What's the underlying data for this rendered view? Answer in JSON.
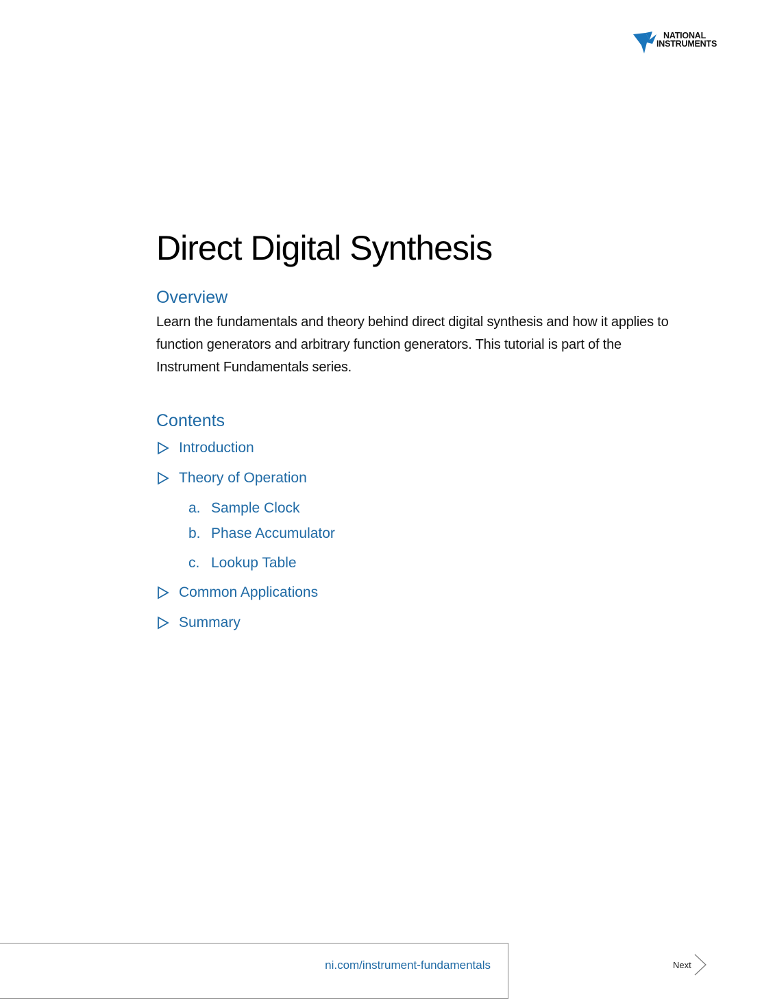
{
  "header": {
    "logo": {
      "icon": "ni-eagle-logo",
      "line1": "NATIONAL",
      "line2": "INSTRUMENTS",
      "brand_color": "#1a75bb"
    }
  },
  "document": {
    "title": "Direct Digital Synthesis",
    "overview": {
      "heading": "Overview",
      "body": "Learn the fundamentals and theory behind direct digital synthesis and how it applies to function generators and arbitrary function generators. This tutorial is part of the Instrument Fundamentals series."
    },
    "contents": {
      "heading": "Contents",
      "items": [
        {
          "label": "Introduction",
          "icon": "triangle-right-outline-icon"
        },
        {
          "label": "Theory of Operation",
          "icon": "triangle-right-outline-icon",
          "subitems": [
            {
              "letter": "a.",
              "label": "Sample Clock"
            },
            {
              "letter": "b.",
              "label": "Phase Accumulator"
            },
            {
              "letter": "c.",
              "label": "Lookup Table"
            }
          ]
        },
        {
          "label": "Common Applications",
          "icon": "triangle-right-outline-icon"
        },
        {
          "label": "Summary",
          "icon": "triangle-right-outline-icon"
        }
      ]
    }
  },
  "footer": {
    "link": "ni.com/instrument-fundamentals",
    "next_label": "Next",
    "next_icon": "chevron-right-icon"
  },
  "colors": {
    "accent": "#1f6aa5",
    "text": "#111111"
  }
}
